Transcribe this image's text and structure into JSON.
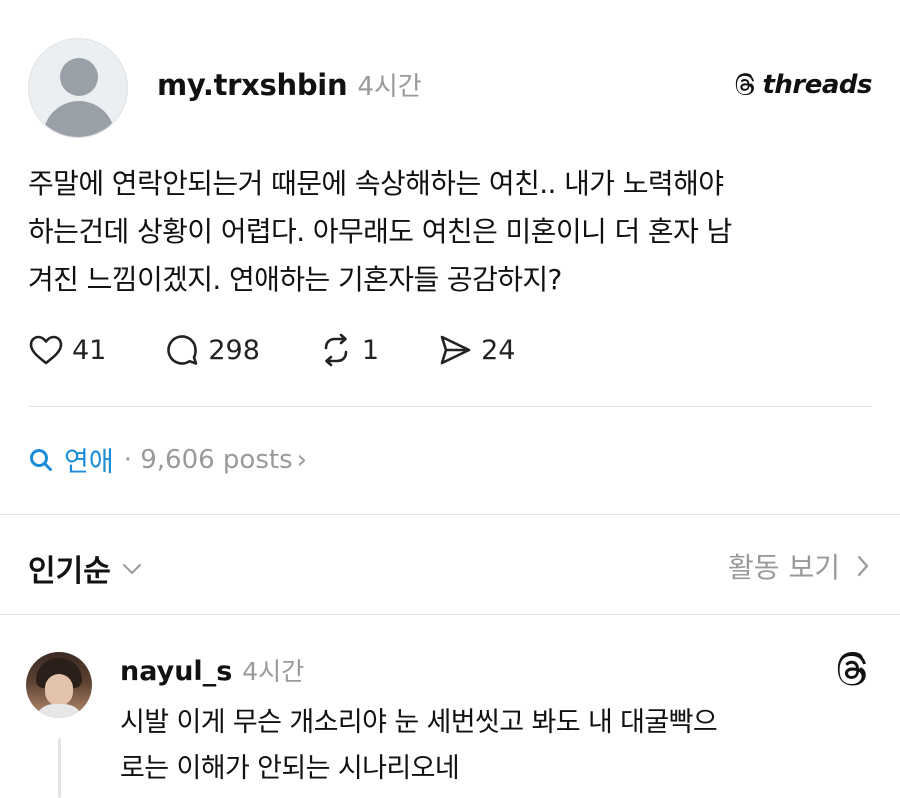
{
  "post": {
    "username": "my.trxshbin",
    "time": "4시간",
    "lines": [
      "주말에 연락안되는거 때문에 속상해하는 여친.. 내가 노력해야",
      "하는건데 상황이 어렵다. 아무래도 여친은 미혼이니 더 혼자 남",
      "겨진 느낌이겠지. 연애하는 기혼자들 공감하지?"
    ],
    "likes": "41",
    "comments": "298",
    "reposts": "1",
    "shares": "24"
  },
  "brand": {
    "text": "threads"
  },
  "topic": {
    "name": "연애",
    "meta": "· 9,606 posts",
    "chevron": "›"
  },
  "sort": {
    "label": "인기순",
    "activity_label": "활동 보기"
  },
  "reply": {
    "username": "nayul_s",
    "time": "4시간",
    "lines": [
      "시발 이게 무슨 개소리야 눈 세번씻고 봐도 내 대굴빡으",
      "로는 이해가 안되는 시나리오네"
    ]
  },
  "icons": {
    "heart": "heart-icon",
    "comment": "comment-icon",
    "repost": "repost-icon",
    "share": "share-icon",
    "search": "search-icon",
    "chevron_down": "chevron-down-icon",
    "chevron_right": "chevron-right-icon",
    "threads_logo": "threads-logo-icon"
  },
  "colors": {
    "accent": "#1a8cd8",
    "muted": "#9a9a9a",
    "text": "#111111",
    "divider": "#e2e2e2"
  }
}
